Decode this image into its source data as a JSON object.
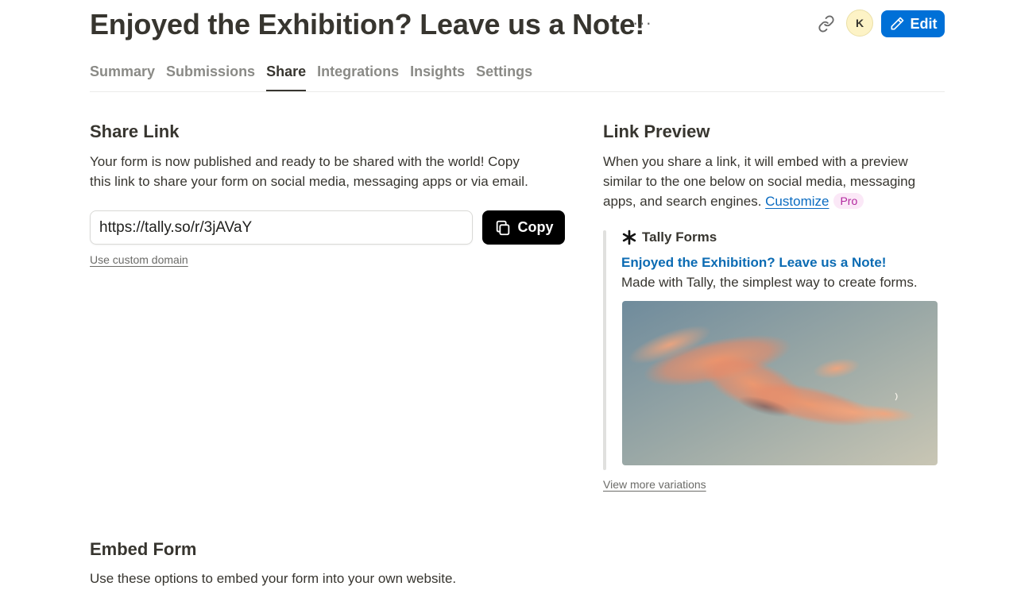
{
  "header": {
    "title": "Enjoyed the Exhibition? Leave us a Note!",
    "more_label": "···",
    "avatar_initial": "K",
    "edit_label": "Edit"
  },
  "tabs": [
    {
      "label": "Summary",
      "active": false
    },
    {
      "label": "Submissions",
      "active": false
    },
    {
      "label": "Share",
      "active": true
    },
    {
      "label": "Integrations",
      "active": false
    },
    {
      "label": "Insights",
      "active": false
    },
    {
      "label": "Settings",
      "active": false
    }
  ],
  "share_link": {
    "heading": "Share Link",
    "description_line1": "Your form is now published and ready to be shared with the world! Copy",
    "description_line2": "this link to share your form on social media, messaging apps or via email.",
    "url": "https://tally.so/r/3jAVaY",
    "copy_label": "Copy",
    "custom_domain_label": "Use custom domain"
  },
  "link_preview": {
    "heading": "Link Preview",
    "description_line1": "When you share a link, it will embed with a preview",
    "description_line2": "similar to the one below on social media, messaging",
    "description_line3": "apps, and search engines.",
    "customize_label": "Customize",
    "pro_badge": "Pro",
    "site_name": "Tally Forms",
    "preview_title": "Enjoyed the Exhibition? Leave us a Note!",
    "preview_description": "Made with Tally, the simplest way to create forms.",
    "view_more_label": "View more variations"
  },
  "embed": {
    "heading": "Embed Form",
    "description": "Use these options to embed your form into your own website."
  },
  "colors": {
    "accent": "#0070d7",
    "preview_title": "#0b6bb3",
    "pro_badge_bg": "#fbe8f7",
    "pro_badge_text": "#b2279e"
  }
}
